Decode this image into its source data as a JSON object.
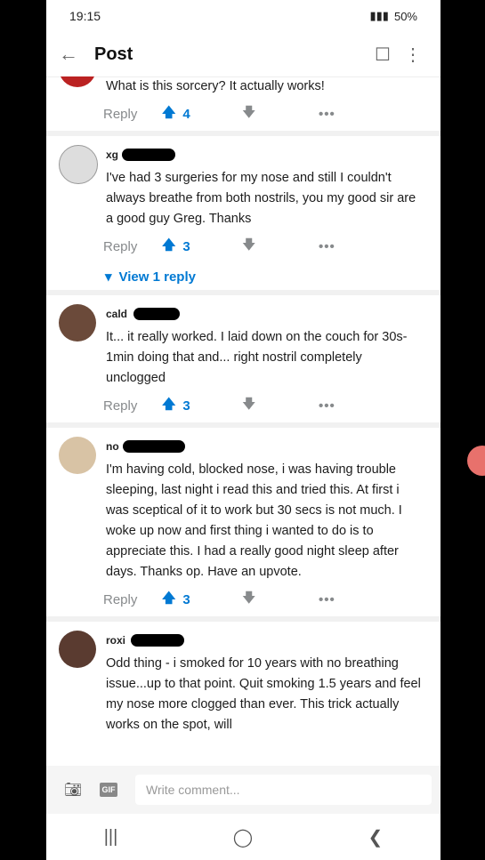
{
  "status": {
    "time": "19:15",
    "battery": "50%"
  },
  "header": {
    "title": "Post"
  },
  "actions_labels": {
    "reply": "Reply",
    "more": "•••"
  },
  "comments": [
    {
      "user": "",
      "text": "What is this sorcery? It actually works!",
      "votes": "4"
    },
    {
      "user": "xg",
      "text": "I've had 3 surgeries for my nose and still I couldn't always breathe from both nostrils, you my good sir are a good guy Greg. Thanks",
      "votes": "3",
      "view_reply": "View 1 reply"
    },
    {
      "user": "cald",
      "text": "It... it really worked. I laid down on the couch for 30s-1min doing that and... right nostril completely unclogged",
      "votes": "3"
    },
    {
      "user": "no",
      "text": "I'm having cold, blocked nose, i was having trouble sleeping, last night i read this and tried this. At first i was sceptical of it to work but 30 secs is not much. I woke up now and first thing i wanted to do is to appreciate this. I had a really good night sleep after days. Thanks op. Have an upvote.",
      "votes": "3"
    },
    {
      "user": "roxi",
      "text": "Odd thing - i smoked for 10 years with no breathing issue...up to that point. Quit smoking 1.5 years and feel my nose more clogged than ever. This trick actually works on the spot, will"
    }
  ],
  "composer": {
    "placeholder": "Write comment...",
    "gif": "GIF"
  },
  "colors": {
    "upvote": "#0079d3",
    "accent": "#e8716c"
  }
}
